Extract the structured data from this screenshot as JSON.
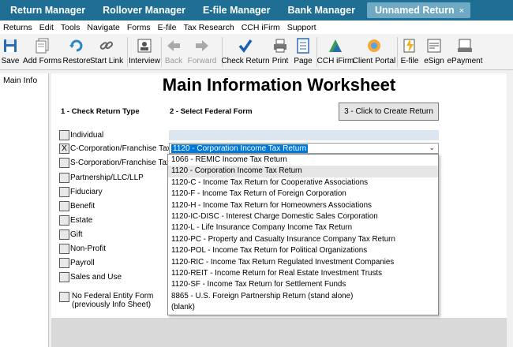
{
  "tabs": [
    {
      "label": "Return Manager"
    },
    {
      "label": "Rollover Manager"
    },
    {
      "label": "E-file Manager"
    },
    {
      "label": "Bank Manager"
    }
  ],
  "active_tab": {
    "label": "Unnamed Return",
    "close": "×"
  },
  "menu": [
    "Returns",
    "Edit",
    "Tools",
    "Navigate",
    "Forms",
    "E-file",
    "Tax Research",
    "CCH iFirm",
    "Support"
  ],
  "toolbar": {
    "save": "Save",
    "add_forms": "Add Forms",
    "restore": "Restore",
    "start_link": "Start Link",
    "interview": "Interview",
    "back": "Back",
    "forward": "Forward",
    "check_return": "Check Return",
    "print": "Print",
    "page": "Page",
    "cch_ifirm": "CCH iFirm",
    "client_portal": "Client Portal",
    "efile": "E-file",
    "esign": "eSign",
    "epayment": "ePayment"
  },
  "left_panel": {
    "item": "Main Info"
  },
  "worksheet": {
    "title": "Main Information Worksheet",
    "section1": "1 - Check Return Type",
    "section2": "2 - Select Federal Form",
    "create_button": "3 - Click to Create Return",
    "return_types": [
      {
        "label": "Individual",
        "mark": ""
      },
      {
        "label": "C-Corporation/Franchise Tax",
        "mark": "X"
      },
      {
        "label": "S-Corporation/Franchise Tax",
        "mark": ""
      },
      {
        "label": "Partnership/LLC/LLP",
        "mark": ""
      },
      {
        "label": "Fiduciary",
        "mark": ""
      },
      {
        "label": "Benefit",
        "mark": ""
      },
      {
        "label": "Estate",
        "mark": ""
      },
      {
        "label": "Gift",
        "mark": ""
      },
      {
        "label": "Non-Profit",
        "mark": ""
      },
      {
        "label": "Payroll",
        "mark": ""
      },
      {
        "label": "Sales and Use",
        "mark": ""
      }
    ],
    "no_federal_line1": "No Federal Entity Form",
    "no_federal_line2": "(previously Info Sheet)",
    "federal_form_selected": "1120 - Corporation Income Tax Return",
    "federal_form_options": [
      "1066 - REMIC Income Tax Return",
      "1120 - Corporation Income Tax Return",
      "1120-C - Income Tax Return for Cooperative Associations",
      "1120-F - Income Tax Return of Foreign Corporation",
      "1120-H - Income Tax Return for Homeowners Associations",
      "1120-IC-DISC - Interest Charge Domestic Sales Corporation",
      "1120-L - Life Insurance Company Income Tax Return",
      "1120-PC - Property and Casualty Insurance Company Tax Return",
      "1120-POL - Income Tax Return for Political Organizations",
      "1120-RIC - Income Tax Return Regulated Investment Companies",
      "1120-REIT - Income Return for Real Estate Investment Trusts",
      "1120-SF - Income Tax Return for Settlement Funds",
      "8865 - U.S. Foreign Partnership Return (stand alone)",
      "(blank)"
    ],
    "highlighted_option_index": 1
  },
  "colors": {
    "tabbar": "#1f6f95",
    "active_tab": "#6fa9c4",
    "selection": "#0078d7"
  }
}
